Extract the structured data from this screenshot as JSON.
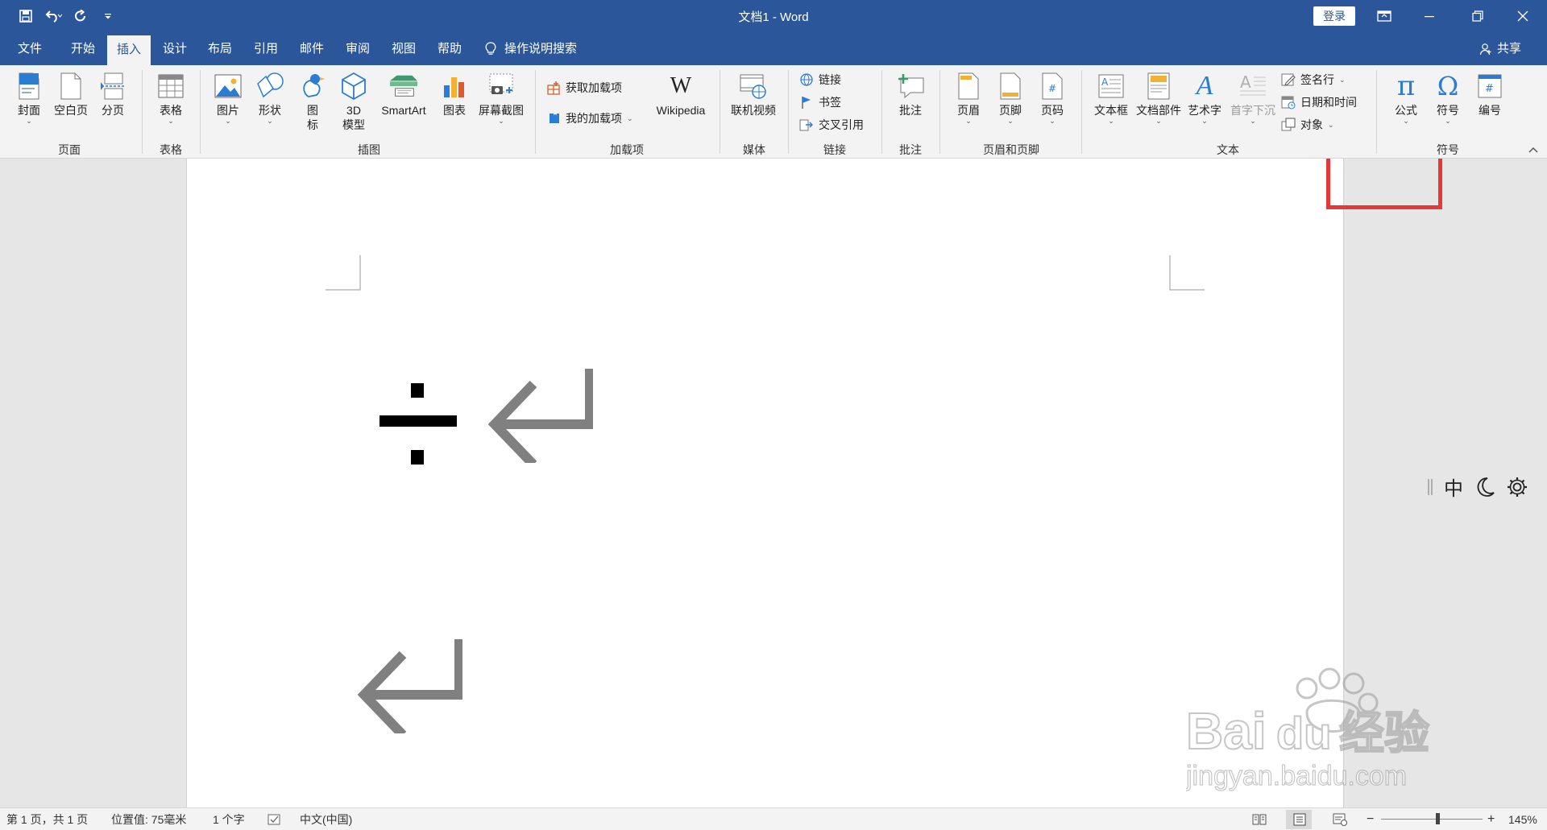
{
  "window": {
    "title": "文档1  -  Word",
    "login_label": "登录"
  },
  "tabs": [
    {
      "label": "文件"
    },
    {
      "label": "开始"
    },
    {
      "label": "插入"
    },
    {
      "label": "设计"
    },
    {
      "label": "布局"
    },
    {
      "label": "引用"
    },
    {
      "label": "邮件"
    },
    {
      "label": "审阅"
    },
    {
      "label": "视图"
    },
    {
      "label": "帮助"
    }
  ],
  "tell_me": "操作说明搜索",
  "share": "共享",
  "ribbon": {
    "pages": {
      "cover": "封面",
      "blank": "空白页",
      "break": "分页",
      "group": "页面"
    },
    "tables": {
      "table": "表格",
      "group": "表格"
    },
    "illustrations": {
      "pictures": "图片",
      "shapes": "形状",
      "icons": "图\n标",
      "models3d": "3D\n模型",
      "smartart": "SmartArt",
      "chart": "图表",
      "screenshot": "屏幕截图",
      "group": "插图"
    },
    "addins": {
      "get": "获取加载项",
      "my": "我的加载项",
      "wiki": "Wikipedia",
      "group": "加载项"
    },
    "media": {
      "video": "联机视频",
      "group": "媒体"
    },
    "links": {
      "link": "链接",
      "bookmark": "书签",
      "crossref": "交叉引用",
      "group": "链接"
    },
    "comments": {
      "comment": "批注",
      "group": "批注"
    },
    "headerfooter": {
      "header": "页眉",
      "footer": "页脚",
      "pagenum": "页码",
      "group": "页眉和页脚"
    },
    "text": {
      "textbox": "文本框",
      "quickparts": "文档部件",
      "wordart": "艺术字",
      "dropcap": "首字下沉",
      "signature": "签名行",
      "datetime": "日期和时间",
      "object": "对象",
      "group": "文本"
    },
    "symbols": {
      "equation": "公式",
      "symbol": "符号",
      "number": "编号",
      "group": "符号"
    }
  },
  "ime": {
    "mode": "中"
  },
  "document": {
    "content_symbol": "÷"
  },
  "watermark": {
    "brand": "Baidu经验",
    "url": "jingyan.baidu.com"
  },
  "status": {
    "page": "第 1 页，共 1 页",
    "position": "位置值: 75毫米",
    "words": "1 个字",
    "language": "中文(中国)",
    "zoom": "145%",
    "zoom_minus": "−",
    "zoom_plus": "+"
  },
  "colors": {
    "brand": "#2b579a",
    "highlight_box": "#e53935"
  }
}
